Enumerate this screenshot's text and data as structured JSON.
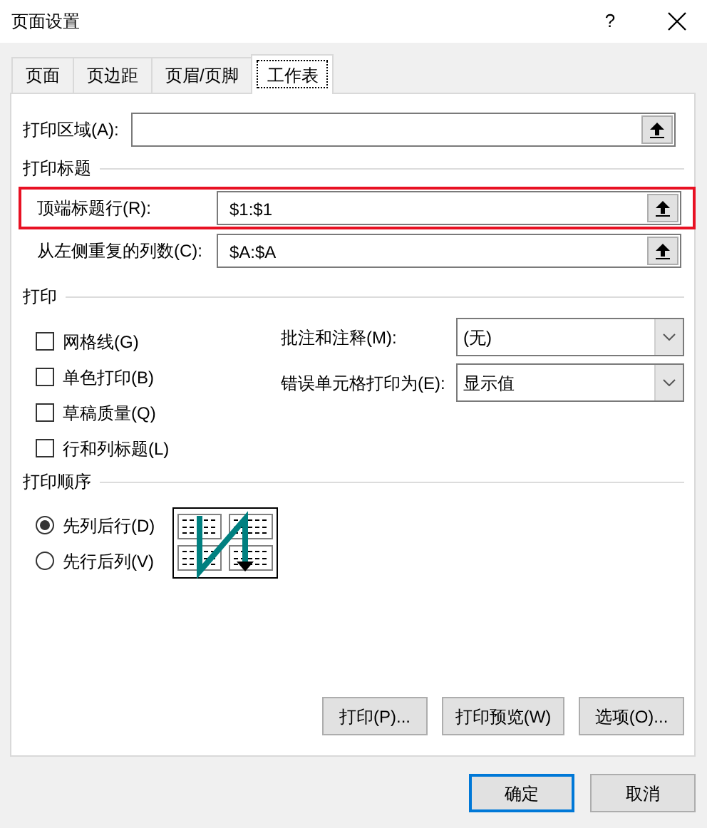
{
  "window": {
    "title": "页面设置",
    "help": "?"
  },
  "tabs": [
    {
      "label": "页面",
      "selected": false
    },
    {
      "label": "页边距",
      "selected": false
    },
    {
      "label": "页眉/页脚",
      "selected": false
    },
    {
      "label": "工作表",
      "selected": true
    }
  ],
  "print_area": {
    "label": "打印区域(A):"
  },
  "print_titles": {
    "heading": "打印标题",
    "rows": [
      {
        "label": "顶端标题行(R):",
        "value": "$1:$1",
        "highlighted": true
      },
      {
        "label": "从左侧重复的列数(C):",
        "value": "$A:$A",
        "highlighted": false
      }
    ]
  },
  "print": {
    "heading": "打印",
    "checkboxes": [
      {
        "label": "网格线(G)",
        "checked": false
      },
      {
        "label": "单色打印(B)",
        "checked": false
      },
      {
        "label": "草稿质量(Q)",
        "checked": false
      },
      {
        "label": "行和列标题(L)",
        "checked": false
      }
    ],
    "dropdowns": [
      {
        "label": "批注和注释(M):",
        "value": "(无)"
      },
      {
        "label": "错误单元格打印为(E):",
        "value": "显示值"
      }
    ]
  },
  "print_order": {
    "heading": "打印顺序",
    "options": [
      {
        "label": "先列后行(D)",
        "selected": true
      },
      {
        "label": "先行后列(V)",
        "selected": false
      }
    ]
  },
  "buttons": [
    "打印(P)...",
    "打印预览(W)",
    "选项(O)..."
  ],
  "footer_buttons": [
    {
      "label": "确定",
      "default": true
    },
    {
      "label": "取消",
      "default": false
    }
  ]
}
